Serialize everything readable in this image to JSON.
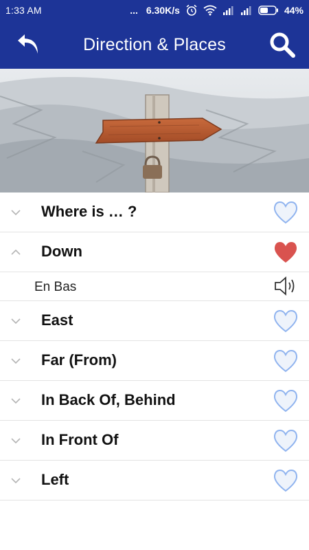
{
  "status_bar": {
    "time": "1:33 AM",
    "dots": "...",
    "speed": "6.30K/s",
    "battery": "44%",
    "icons": [
      "alarm-icon",
      "wifi-icon",
      "signal-icon",
      "signal-icon",
      "battery-icon"
    ]
  },
  "toolbar": {
    "title": "Direction & Places",
    "back_icon": "back-arrow-icon",
    "search_icon": "search-icon",
    "color": "#1d3497"
  },
  "hero": {
    "image": "wooden-arrow-signpost-snowy-mountain"
  },
  "list": {
    "items": [
      {
        "title": "Where is … ?",
        "expanded": false,
        "favorite": false
      },
      {
        "title": "Down",
        "expanded": true,
        "favorite": true,
        "translation": "En Bas"
      },
      {
        "title": "East",
        "expanded": false,
        "favorite": false
      },
      {
        "title": "Far (From)",
        "expanded": false,
        "favorite": false
      },
      {
        "title": "In Back Of, Behind",
        "expanded": false,
        "favorite": false
      },
      {
        "title": "In Front Of",
        "expanded": false,
        "favorite": false
      },
      {
        "title": "Left",
        "expanded": false,
        "favorite": false
      }
    ],
    "heart_outline_color": "#8fb3ef",
    "heart_fill_color": "#d9534f"
  }
}
